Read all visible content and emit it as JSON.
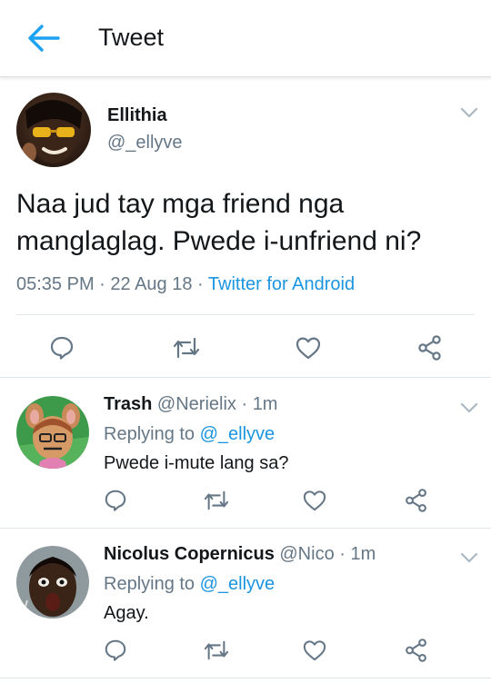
{
  "header": {
    "title": "Tweet"
  },
  "tweet": {
    "author_name": "Ellithia",
    "author_handle": "@_ellyve",
    "text": "Naa jud tay mga friend nga manglaglag. Pwede i-unfriend ni?",
    "time": "05:35 PM",
    "sep1": " · ",
    "date": "22 Aug 18",
    "sep2": " · ",
    "source": "Twitter for Android"
  },
  "replies": [
    {
      "name": "Trash",
      "handle": "@Nerielix",
      "sep": " · ",
      "time": "1m",
      "replying_label": "Replying to ",
      "replying_to": "@_ellyve",
      "text": "Pwede i-mute lang sa?"
    },
    {
      "name": "Nicolus Copernicus",
      "handle": "@Nico",
      "sep": " · ",
      "time": "1m",
      "replying_label": "Replying to ",
      "replying_to": "@_ellyve",
      "text": "Agay."
    }
  ],
  "icons": {
    "back": "arrow-left-icon",
    "reply": "reply-icon",
    "retweet": "retweet-icon",
    "like": "heart-icon",
    "share": "share-icon",
    "more": "chevron-down-icon"
  },
  "colors": {
    "accent": "#1da1f2",
    "link": "#1b95e0",
    "muted": "#657786",
    "icon": "#657786"
  }
}
